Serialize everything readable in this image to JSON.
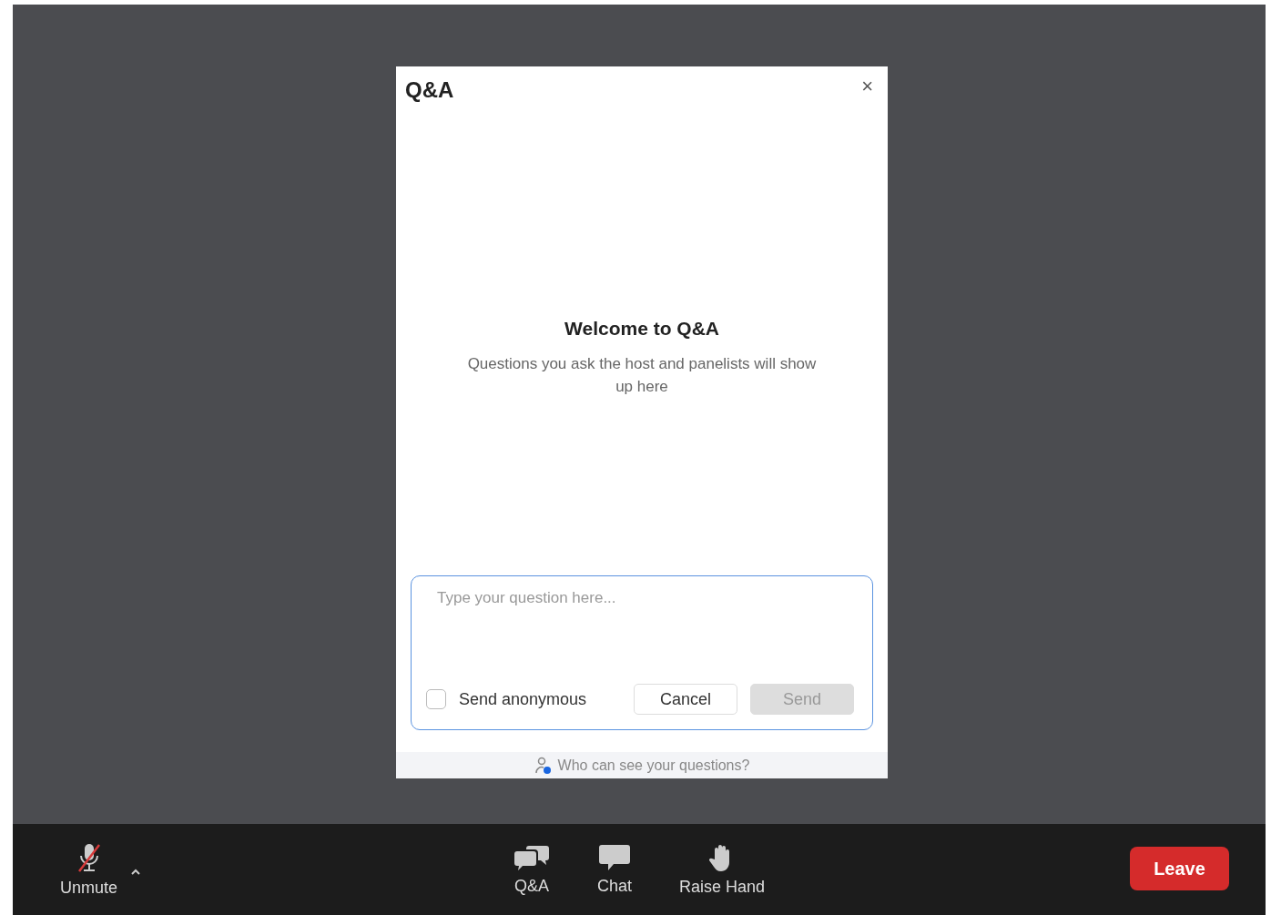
{
  "dialog": {
    "title": "Q&A",
    "close": "×",
    "welcome_title": "Welcome to Q&A",
    "welcome_text": "Questions you ask the host and panelists will show up here",
    "question_field": {
      "placeholder": "Type your question here..."
    },
    "anonymous": {
      "label": "Send anonymous",
      "checked": false
    },
    "buttons": [
      {
        "label": "Cancel",
        "kind": "secondary",
        "disabled": false
      },
      {
        "label": "Send",
        "kind": "primary",
        "disabled": true
      }
    ],
    "footer_link": "Who can see your questions?"
  },
  "toolbar": {
    "mute": {
      "label": "Unmute",
      "muted": true
    },
    "items": [
      {
        "label": "Q&A",
        "kind": "qa"
      },
      {
        "label": "Chat",
        "kind": "chat"
      },
      {
        "label": "Raise Hand",
        "kind": "hand"
      }
    ],
    "leave": "Leave"
  }
}
